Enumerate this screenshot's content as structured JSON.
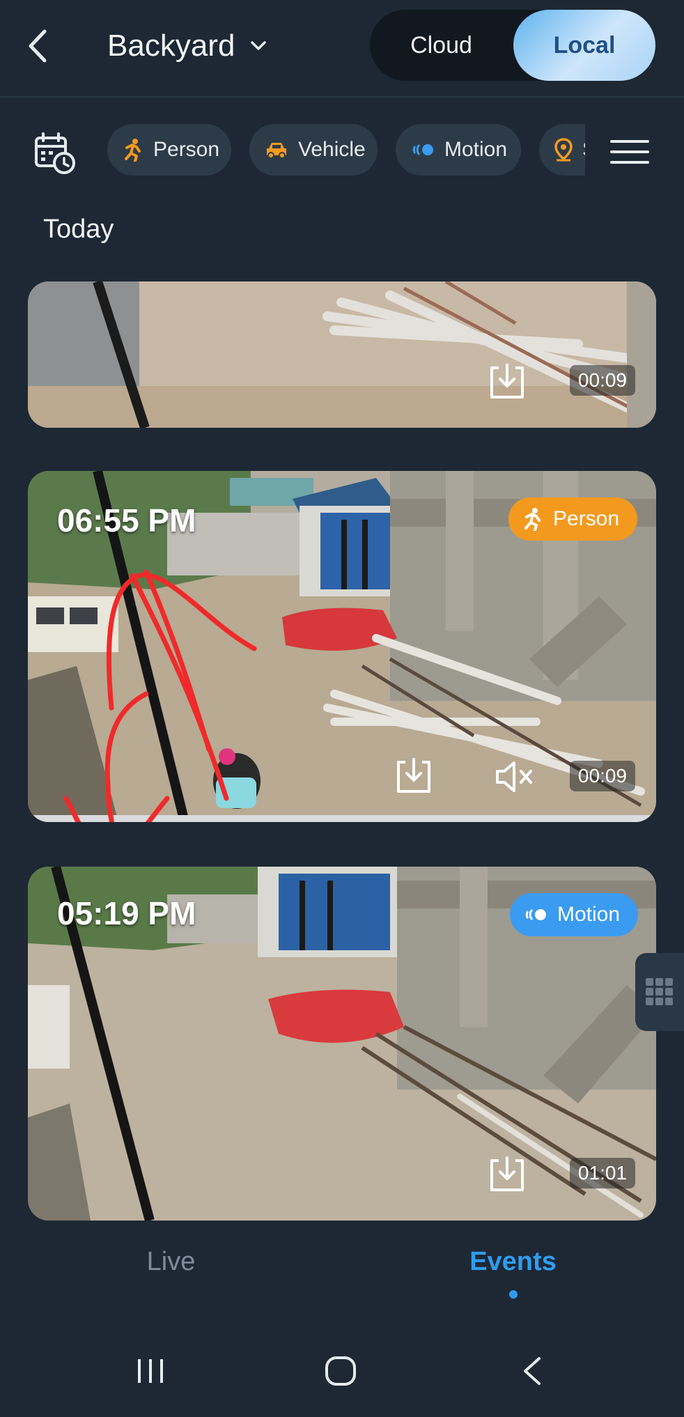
{
  "header": {
    "title": "Backyard",
    "toggle": {
      "cloud_label": "Cloud",
      "local_label": "Local",
      "active": "Local"
    }
  },
  "filters": {
    "chips": [
      {
        "label": "Person",
        "icon": "person-running-icon",
        "color": "#f39a1e"
      },
      {
        "label": "Vehicle",
        "icon": "car-icon",
        "color": "#f39a1e"
      },
      {
        "label": "Motion",
        "icon": "motion-icon",
        "color": "#3a9bf0"
      },
      {
        "label": "S",
        "icon": "location-pin-icon",
        "color": "#f39a1e"
      }
    ]
  },
  "section_title": "Today",
  "events": [
    {
      "time": "",
      "badge": "",
      "duration": "00:09"
    },
    {
      "time": "06:55 PM",
      "badge": "Person",
      "badge_color": "#f39a1e",
      "duration": "00:09"
    },
    {
      "time": "05:19 PM",
      "badge": "Motion",
      "badge_color": "#3a9bf0",
      "duration": "01:01"
    }
  ],
  "bottom_nav": {
    "live_label": "Live",
    "events_label": "Events",
    "active": "Events"
  },
  "colors": {
    "background": "#1d2834",
    "accent": "#2f9cf0",
    "person": "#f39a1e",
    "motion": "#3a9bf0"
  }
}
